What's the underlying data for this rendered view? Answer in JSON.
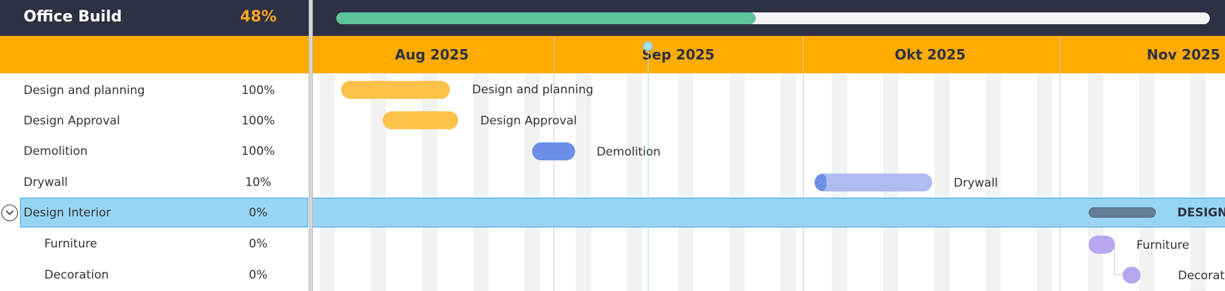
{
  "project": {
    "title": "Office Build",
    "progress_label": "48%",
    "progress_fraction": 0.48
  },
  "timeline": {
    "months": [
      "Aug 2025",
      "Sep 2025",
      "Okt 2025",
      "Nov 2025"
    ]
  },
  "tasks": [
    {
      "name": "Design and planning",
      "progress_label": "100%",
      "progress_fraction": 1.0,
      "level": 0,
      "bar_label": "Design and planning",
      "bar_color": "#fdc24a",
      "fill_color": "#fdc24a"
    },
    {
      "name": "Design Approval",
      "progress_label": "100%",
      "progress_fraction": 1.0,
      "level": 0,
      "bar_label": "Design Approval",
      "bar_color": "#fdc24a",
      "fill_color": "#fdc24a"
    },
    {
      "name": "Demolition",
      "progress_label": "100%",
      "progress_fraction": 1.0,
      "level": 0,
      "bar_label": "Demolition",
      "bar_color": "#6e8fe8",
      "fill_color": "#6e8fe8"
    },
    {
      "name": "Drywall",
      "progress_label": "10%",
      "progress_fraction": 0.1,
      "level": 0,
      "bar_label": "Drywall",
      "bar_color": "#aebcf2",
      "fill_color": "#6e8fe8"
    },
    {
      "name": "Design Interior",
      "progress_label": "0%",
      "progress_fraction": 0.0,
      "level": 0,
      "bar_label": "DESIGN",
      "bar_color": "#637e96",
      "fill_color": "#637e96",
      "selected": true,
      "summary": true
    },
    {
      "name": "Furniture",
      "progress_label": "0%",
      "progress_fraction": 0.0,
      "level": 1,
      "bar_label": "Furniture",
      "bar_color": "#b7a6ee",
      "fill_color": "#b7a6ee"
    },
    {
      "name": "Decoration",
      "progress_label": "0%",
      "progress_fraction": 0.0,
      "level": 1,
      "bar_label": "Decorati",
      "bar_color": "#b7a6ee",
      "fill_color": "#b7a6ee"
    }
  ],
  "colors": {
    "header_bg": "#2e3142",
    "band_bg": "#ffab00",
    "selected_bg": "#97d5f3",
    "progress_green": "#5cc39b",
    "accent_orange": "#f5a623"
  },
  "icons": {
    "collapse": "chevron-down-circle-icon"
  }
}
